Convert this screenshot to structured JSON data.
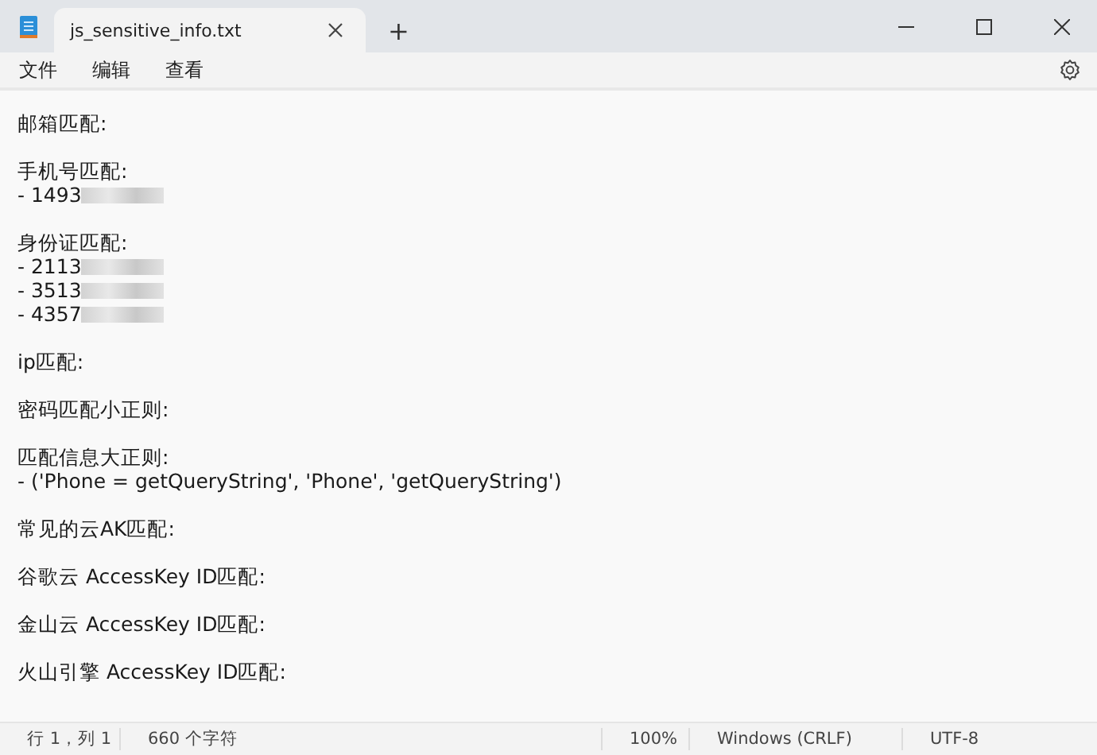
{
  "tab": {
    "title": "js_sensitive_info.txt",
    "add": "+"
  },
  "menu": [
    "文件",
    "编辑",
    "查看"
  ],
  "sections": [
    {
      "heading": "邮箱匹配:"
    },
    {
      "heading": "手机号匹配:",
      "items": [
        {
          "text": "- 1493",
          "redacted": true
        }
      ]
    },
    {
      "heading": "身份证匹配:",
      "items": [
        {
          "text": "- 2113",
          "redacted": true
        },
        {
          "text": "- 3513",
          "redacted": true
        },
        {
          "text": "- 4357",
          "redacted": true
        }
      ]
    },
    {
      "heading": "ip匹配:"
    },
    {
      "heading": "密码匹配小正则:"
    },
    {
      "heading": "匹配信息大正则:",
      "items": [
        {
          "text": "- ('Phone = getQueryString', 'Phone', 'getQueryString')",
          "redacted": false
        }
      ]
    },
    {
      "heading": "常见的云AK匹配:"
    },
    {
      "heading": "谷歌云 AccessKey ID匹配:"
    },
    {
      "heading": "金山云 AccessKey ID匹配:"
    },
    {
      "heading": "火山引擎 AccessKey ID匹配:"
    }
  ],
  "status_bar": {
    "position": "行 1，列 1",
    "count": "660 个字符",
    "zoom": "100%",
    "line_ending": "Windows (CRLF)",
    "encoding": "UTF-8"
  }
}
